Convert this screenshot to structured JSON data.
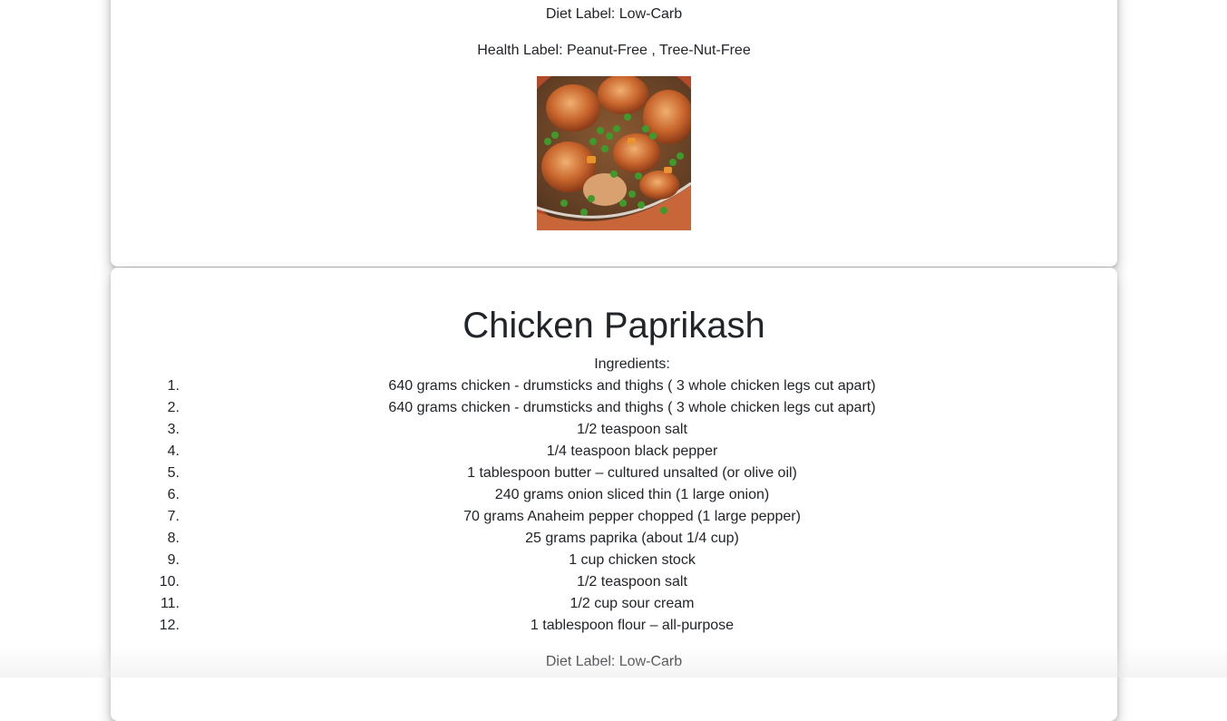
{
  "top_card": {
    "diet_label": "Diet Label: Low-Carb",
    "health_label": "Health Label: Peanut-Free , Tree-Nut-Free"
  },
  "recipe": {
    "title": "Chicken Paprikash",
    "ingredients_label": "Ingredients:",
    "ingredients": [
      {
        "num": "1.",
        "text": "640 grams chicken - drumsticks and thighs ( 3 whole chicken legs cut apart)"
      },
      {
        "num": "2.",
        "text": "640 grams chicken - drumsticks and thighs ( 3 whole chicken legs cut apart)"
      },
      {
        "num": "3.",
        "text": "1/2 teaspoon salt"
      },
      {
        "num": "4.",
        "text": "1/4 teaspoon black pepper"
      },
      {
        "num": "5.",
        "text": "1 tablespoon butter – cultured unsalted (or olive oil)"
      },
      {
        "num": "6.",
        "text": "240 grams onion sliced thin (1 large onion)"
      },
      {
        "num": "7.",
        "text": "70 grams Anaheim pepper chopped (1 large pepper)"
      },
      {
        "num": "8.",
        "text": "25 grams paprika (about 1/4 cup)"
      },
      {
        "num": "9.",
        "text": "1 cup chicken stock"
      },
      {
        "num": "10.",
        "text": "1/2 teaspoon salt"
      },
      {
        "num": "11.",
        "text": "1/2 cup sour cream"
      },
      {
        "num": "12.",
        "text": "1 tablespoon flour – all-purpose"
      }
    ],
    "diet_label": "Diet Label: Low-Carb"
  }
}
